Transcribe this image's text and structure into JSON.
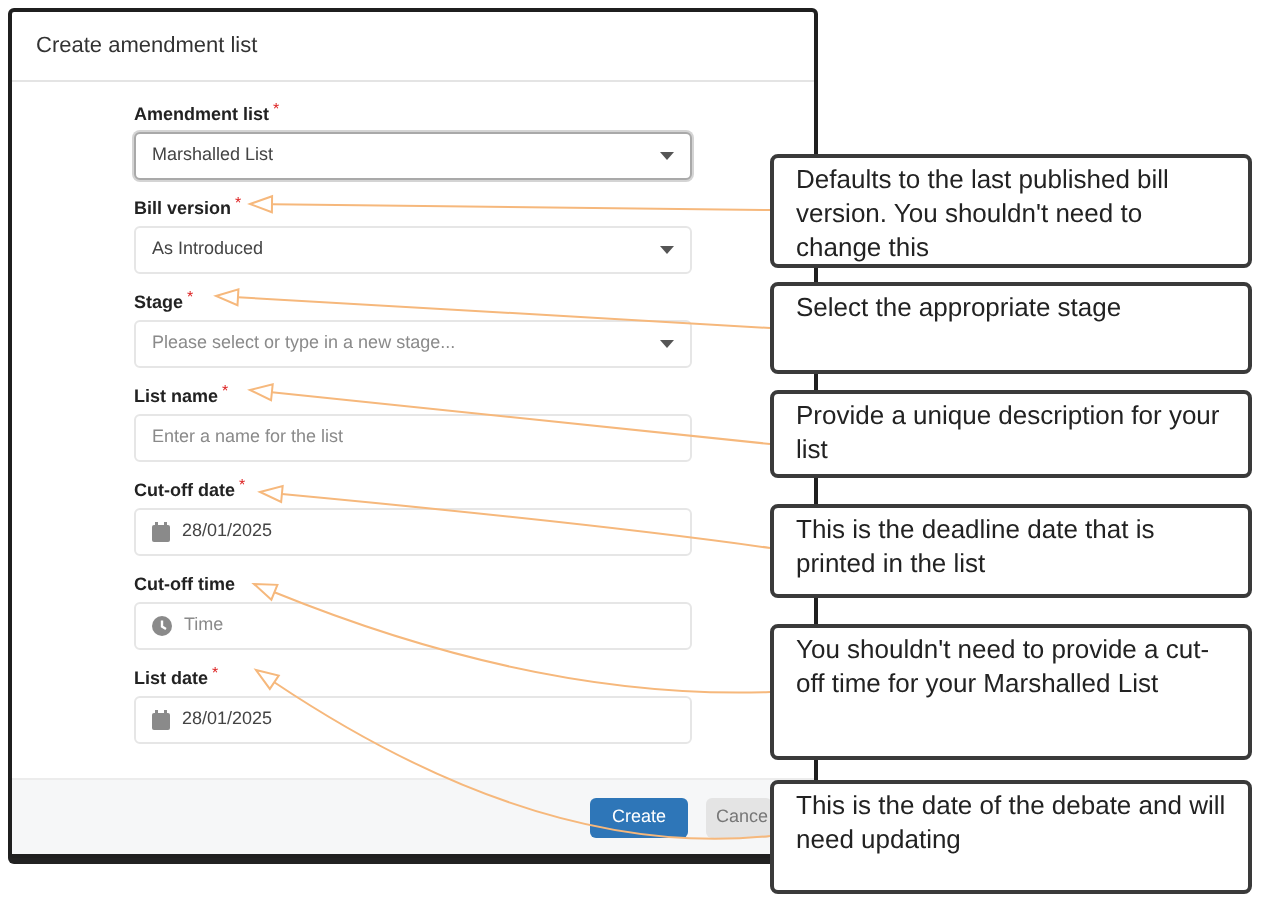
{
  "dialog": {
    "title": "Create amendment list",
    "fields": [
      {
        "label": "Amendment list",
        "marker": "*",
        "kind": "select",
        "value": "Marshalled List",
        "focused": true
      },
      {
        "label": "Bill version",
        "marker": "*",
        "kind": "select",
        "value": "As Introduced",
        "focused": false
      },
      {
        "label": "Stage",
        "marker": "*",
        "kind": "select",
        "placeholder": "Please select or type in a new stage...",
        "focused": false
      },
      {
        "label": "List name",
        "marker": "*",
        "kind": "text",
        "placeholder": "Enter a name for the list",
        "focused": false
      },
      {
        "label": "Cut-off date",
        "marker": "*",
        "kind": "date",
        "value": "28/01/2025",
        "focused": false
      },
      {
        "label": "Cut-off time",
        "kind": "time",
        "placeholder": "Time",
        "focused": false
      },
      {
        "label": "List date",
        "marker": "*",
        "kind": "date",
        "value": "28/01/2025",
        "focused": false
      }
    ],
    "buttons": [
      {
        "label": "Create",
        "kind": "primary"
      },
      {
        "label": "Cance",
        "kind": "secondary"
      }
    ]
  },
  "callouts": [
    "Defaults to the last published bill version. You shouldn't need to change this",
    "Select the appropriate stage",
    "Provide a unique description for your list",
    "This is the deadline date that is printed in the list",
    "You shouldn't need to provide a cut-off time for your Marshalled List",
    "This is the date of the debate and will need updating"
  ]
}
